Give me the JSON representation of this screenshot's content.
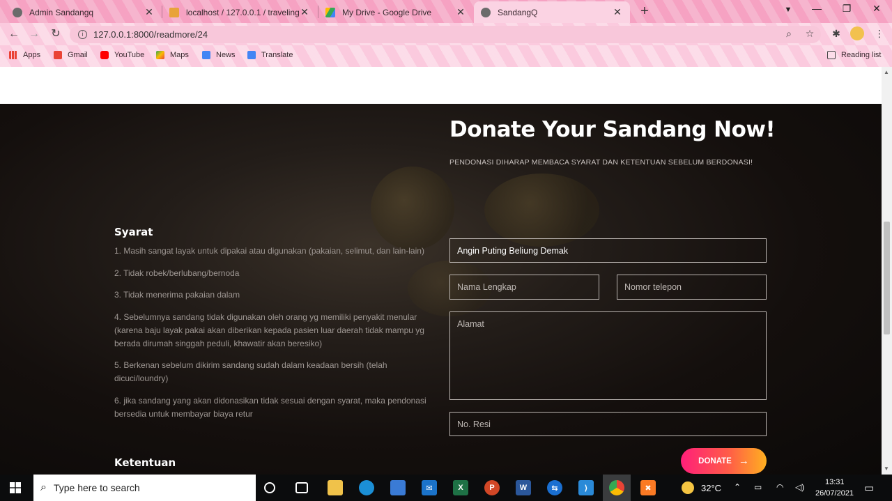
{
  "browser": {
    "tabs": [
      {
        "title": "Admin Sandangq",
        "favicon_color": "#6b6b6b"
      },
      {
        "title": "localhost / 127.0.0.1 / travelingk…",
        "favicon_color": "#e8a33a"
      },
      {
        "title": "My Drive - Google Drive",
        "favicon_color": "#34a853"
      },
      {
        "title": "SandangQ",
        "favicon_color": "#6b6b6b"
      }
    ],
    "active_tab": 3,
    "url": "127.0.0.1:8000/readmore/24",
    "bookmarks": [
      {
        "label": "Apps",
        "icon": "apps-grid-icon",
        "color": "#ea4335"
      },
      {
        "label": "Gmail",
        "icon": "gmail-icon",
        "color": "#ea4335"
      },
      {
        "label": "YouTube",
        "icon": "youtube-icon",
        "color": "#ff0000"
      },
      {
        "label": "Maps",
        "icon": "maps-icon",
        "color": "#34a853"
      },
      {
        "label": "News",
        "icon": "news-icon",
        "color": "#4285f4"
      },
      {
        "label": "Translate",
        "icon": "translate-icon",
        "color": "#4285f4"
      }
    ],
    "reading_list": "Reading list"
  },
  "page": {
    "heading": "Donate Your Sandang Now!",
    "subheading": "PENDONASI DIHARAP MEMBACA SYARAT DAN KETENTUAN SEBELUM BERDONASI!",
    "syarat_title": "Syarat",
    "syarat": [
      "1. Masih sangat layak untuk dipakai atau digunakan (pakaian, selimut, dan lain-lain)",
      "2. Tidak robek/berlubang/bernoda",
      "3. Tidak menerima pakaian dalam",
      "4. Sebelumnya sandang tidak digunakan oleh orang yg memiliki penyakit menular (karena baju layak pakai akan diberikan kepada pasien luar daerah tidak mampu yg berada dirumah singgah peduli, khawatir akan beresiko)",
      "5. Berkenan sebelum dikirim sandang sudah dalam keadaan bersih (telah dicuci/loundry)",
      "6. jika sandang yang akan didonasikan tidak sesuai dengan syarat, maka pendonasi bersedia untuk membayar biaya retur"
    ],
    "ketentuan_title": "Ketentuan",
    "form": {
      "campaign_value": "Angin Puting Beliung Demak",
      "nama_placeholder": "Nama Lengkap",
      "telepon_placeholder": "Nomor telepon",
      "alamat_placeholder": "Alamat",
      "resi_placeholder": "No. Resi",
      "donate_label": "DONATE"
    }
  },
  "taskbar": {
    "search_placeholder": "Type here to search",
    "weather": "32°C",
    "time": "13:31",
    "date": "26/07/2021"
  }
}
